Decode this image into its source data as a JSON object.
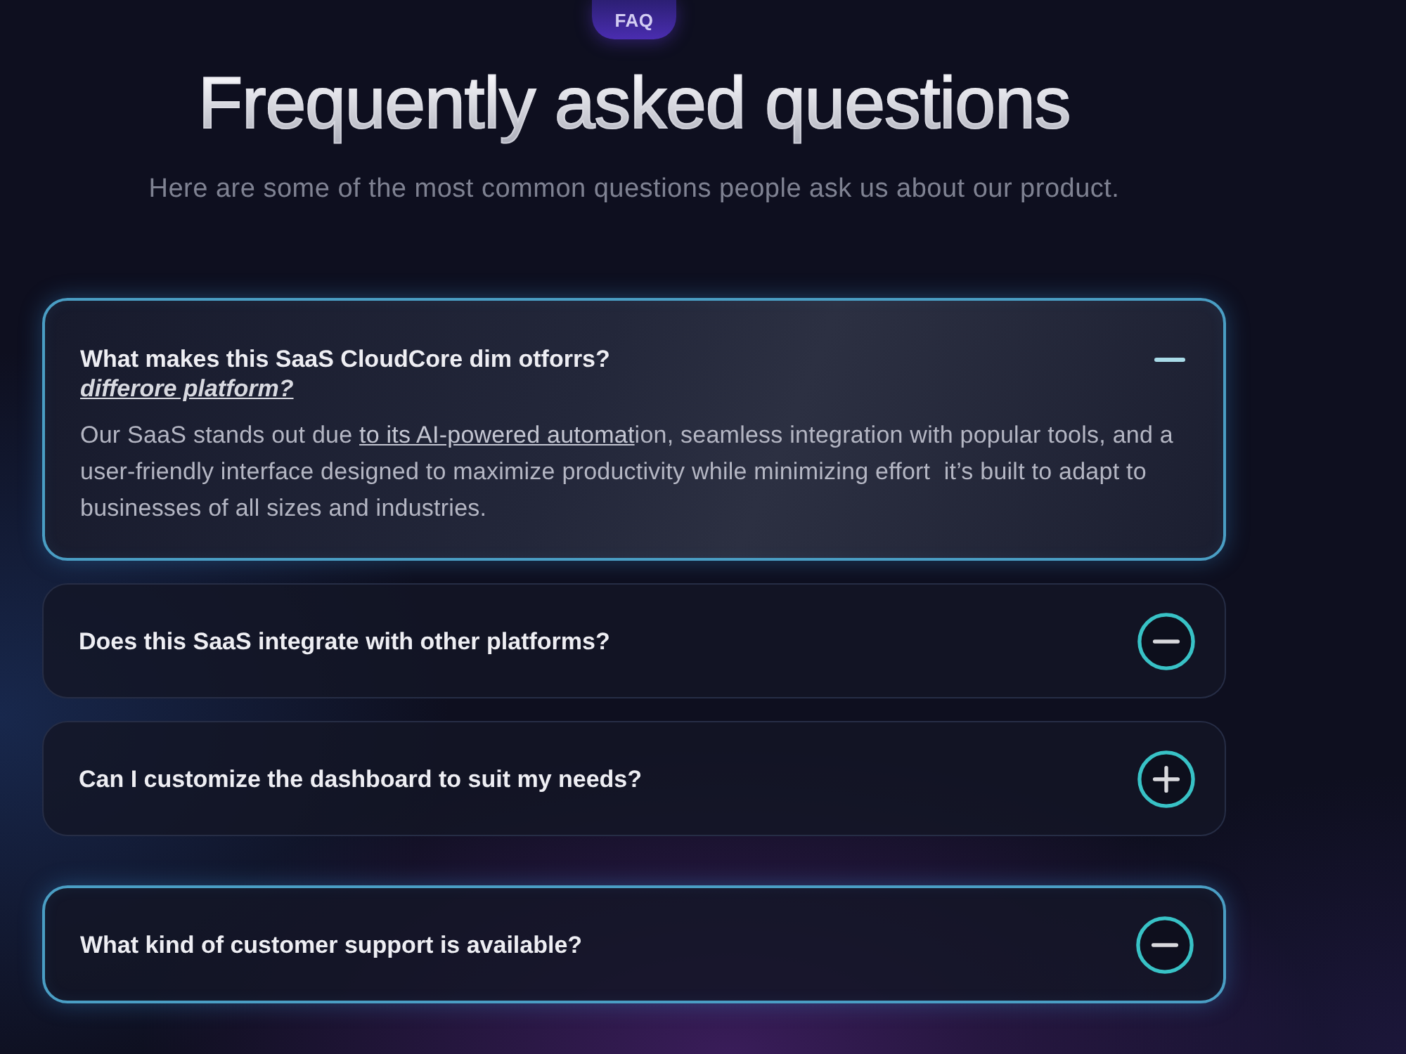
{
  "badge": "FAQ",
  "title": "Frequently asked questions",
  "subtitle": "Here are some of the most common questions people ask us about our product.",
  "items": [
    {
      "question": "What makes this SaaS CloudCore dim otforrs?",
      "question_link": "differore platform?",
      "answer": [
        {
          "kind": "plain",
          "text": "Our SaaS stands out due "
        },
        {
          "kind": "link",
          "text": "to its AI-powered automat"
        },
        {
          "kind": "plain",
          "text": "ion, seamless integration with popular tools, and a user-friendly interface designed to maximize productivity while minimizing effort  it’s built to adapt to businesses of all sizes and industries."
        }
      ],
      "expanded": true,
      "highlighted": true,
      "toggle_open": true
    },
    {
      "question": "Does this SaaS integrate with other platforms?",
      "expanded": false,
      "highlighted": false,
      "toggle_open": true
    },
    {
      "question": "Can I customize the dashboard to suit my needs?",
      "expanded": false,
      "highlighted": false,
      "toggle_open": false
    },
    {
      "question": "What kind of customer support is available?",
      "expanded": false,
      "highlighted": true,
      "toggle_open": true
    }
  ]
}
